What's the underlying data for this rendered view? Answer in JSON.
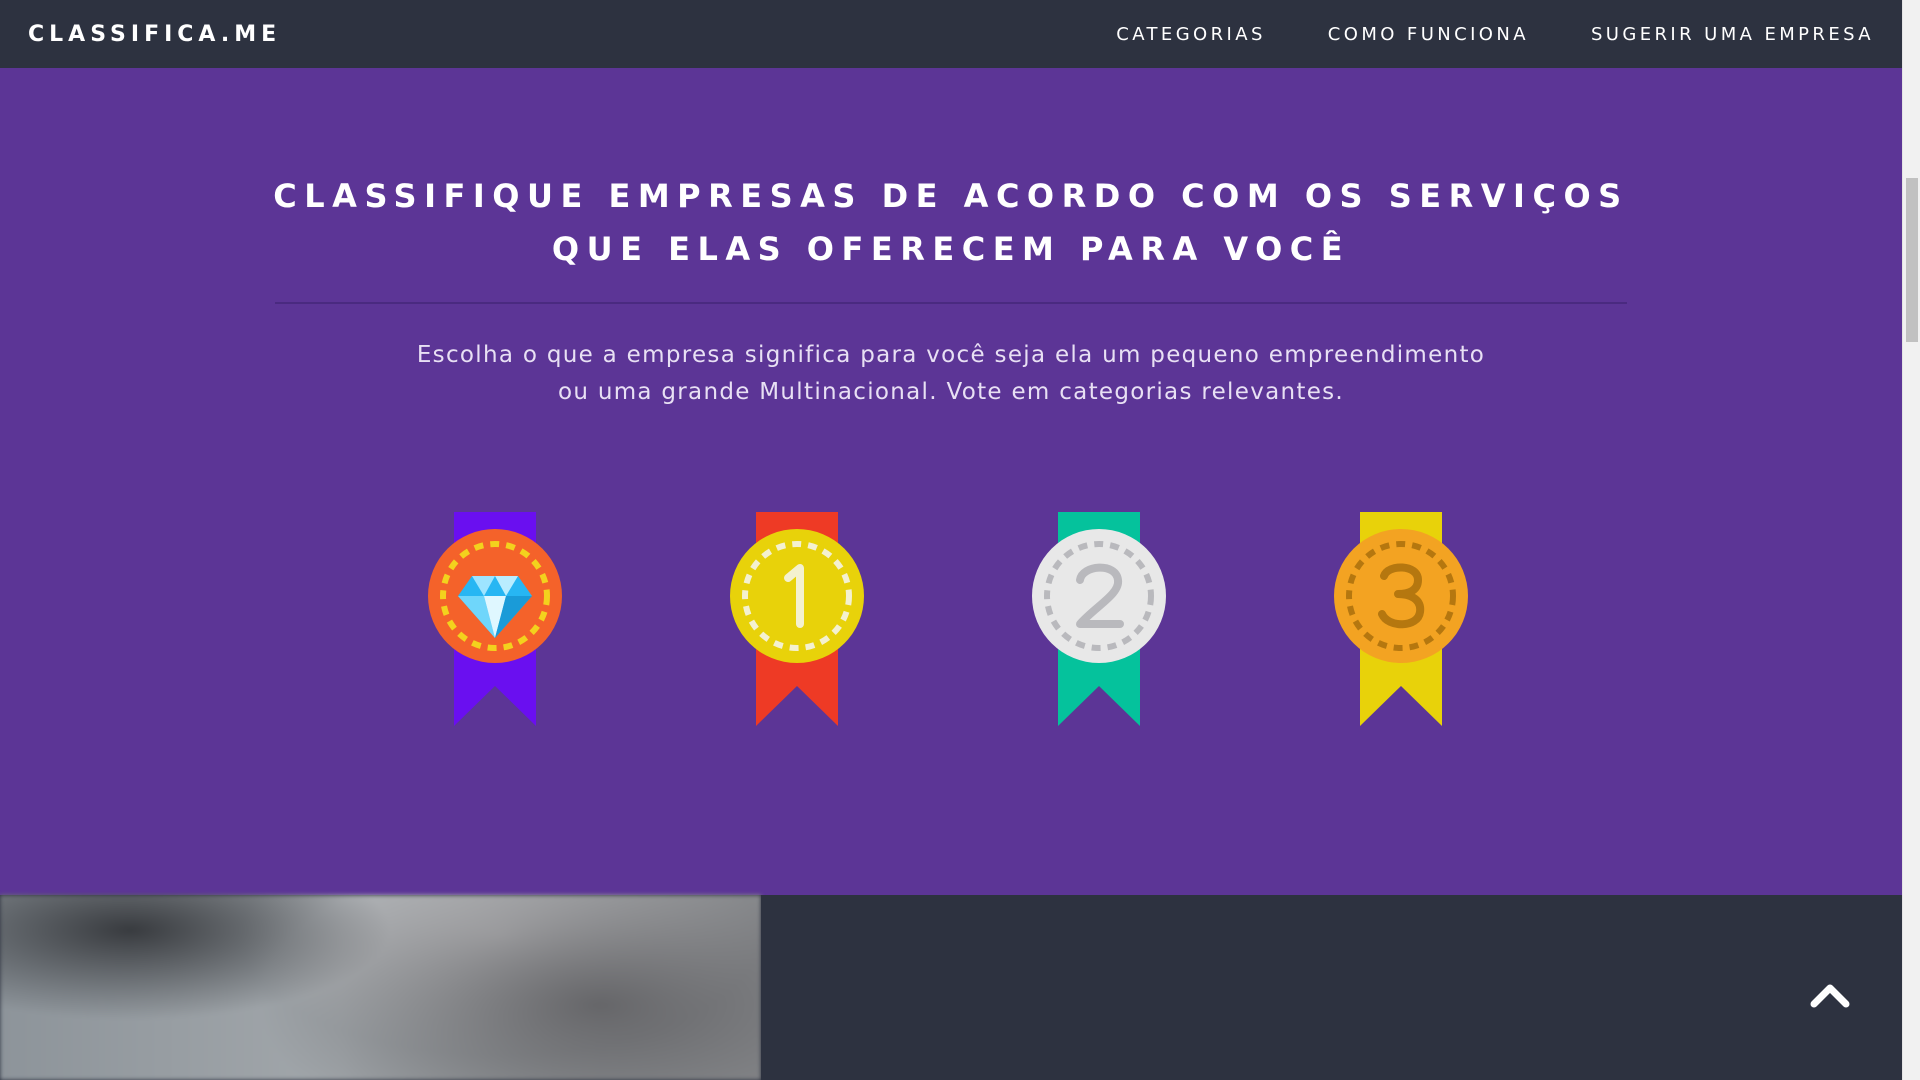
{
  "navbar": {
    "brand": "CLASSIFICA.ME",
    "links": [
      {
        "label": "CATEGORIAS"
      },
      {
        "label": "COMO FUNCIONA"
      },
      {
        "label": "SUGERIR UMA EMPRESA"
      }
    ]
  },
  "hero": {
    "title": "CLASSIFIQUE EMPRESAS DE ACORDO COM OS SERVIÇOS QUE ELAS OFERECEM PARA VOCÊ",
    "subtitle": "Escolha o que a empresa significa para você seja ela um pequeno empreendimento ou uma grande Multinacional. Vote em categorias relevantes.",
    "medals": [
      {
        "name": "diamond-medal",
        "ribbon_color": "#6a0ff0",
        "disc_color": "#f4622a",
        "symbol": ""
      },
      {
        "name": "first-place-medal",
        "ribbon_color": "#ee3a25",
        "disc_color": "#e8d20a",
        "symbol": "1"
      },
      {
        "name": "second-place-medal",
        "ribbon_color": "#05c29c",
        "disc_color": "#e8e8e8",
        "symbol": "2"
      },
      {
        "name": "third-place-medal",
        "ribbon_color": "#e8d20a",
        "disc_color": "#f3a322",
        "symbol": "3"
      }
    ]
  },
  "colors": {
    "navbar_bg": "#2d3240",
    "hero_bg": "#5c3596",
    "text": "#ffffff"
  },
  "icons": {
    "back_to_top": "chevron-up-icon"
  }
}
